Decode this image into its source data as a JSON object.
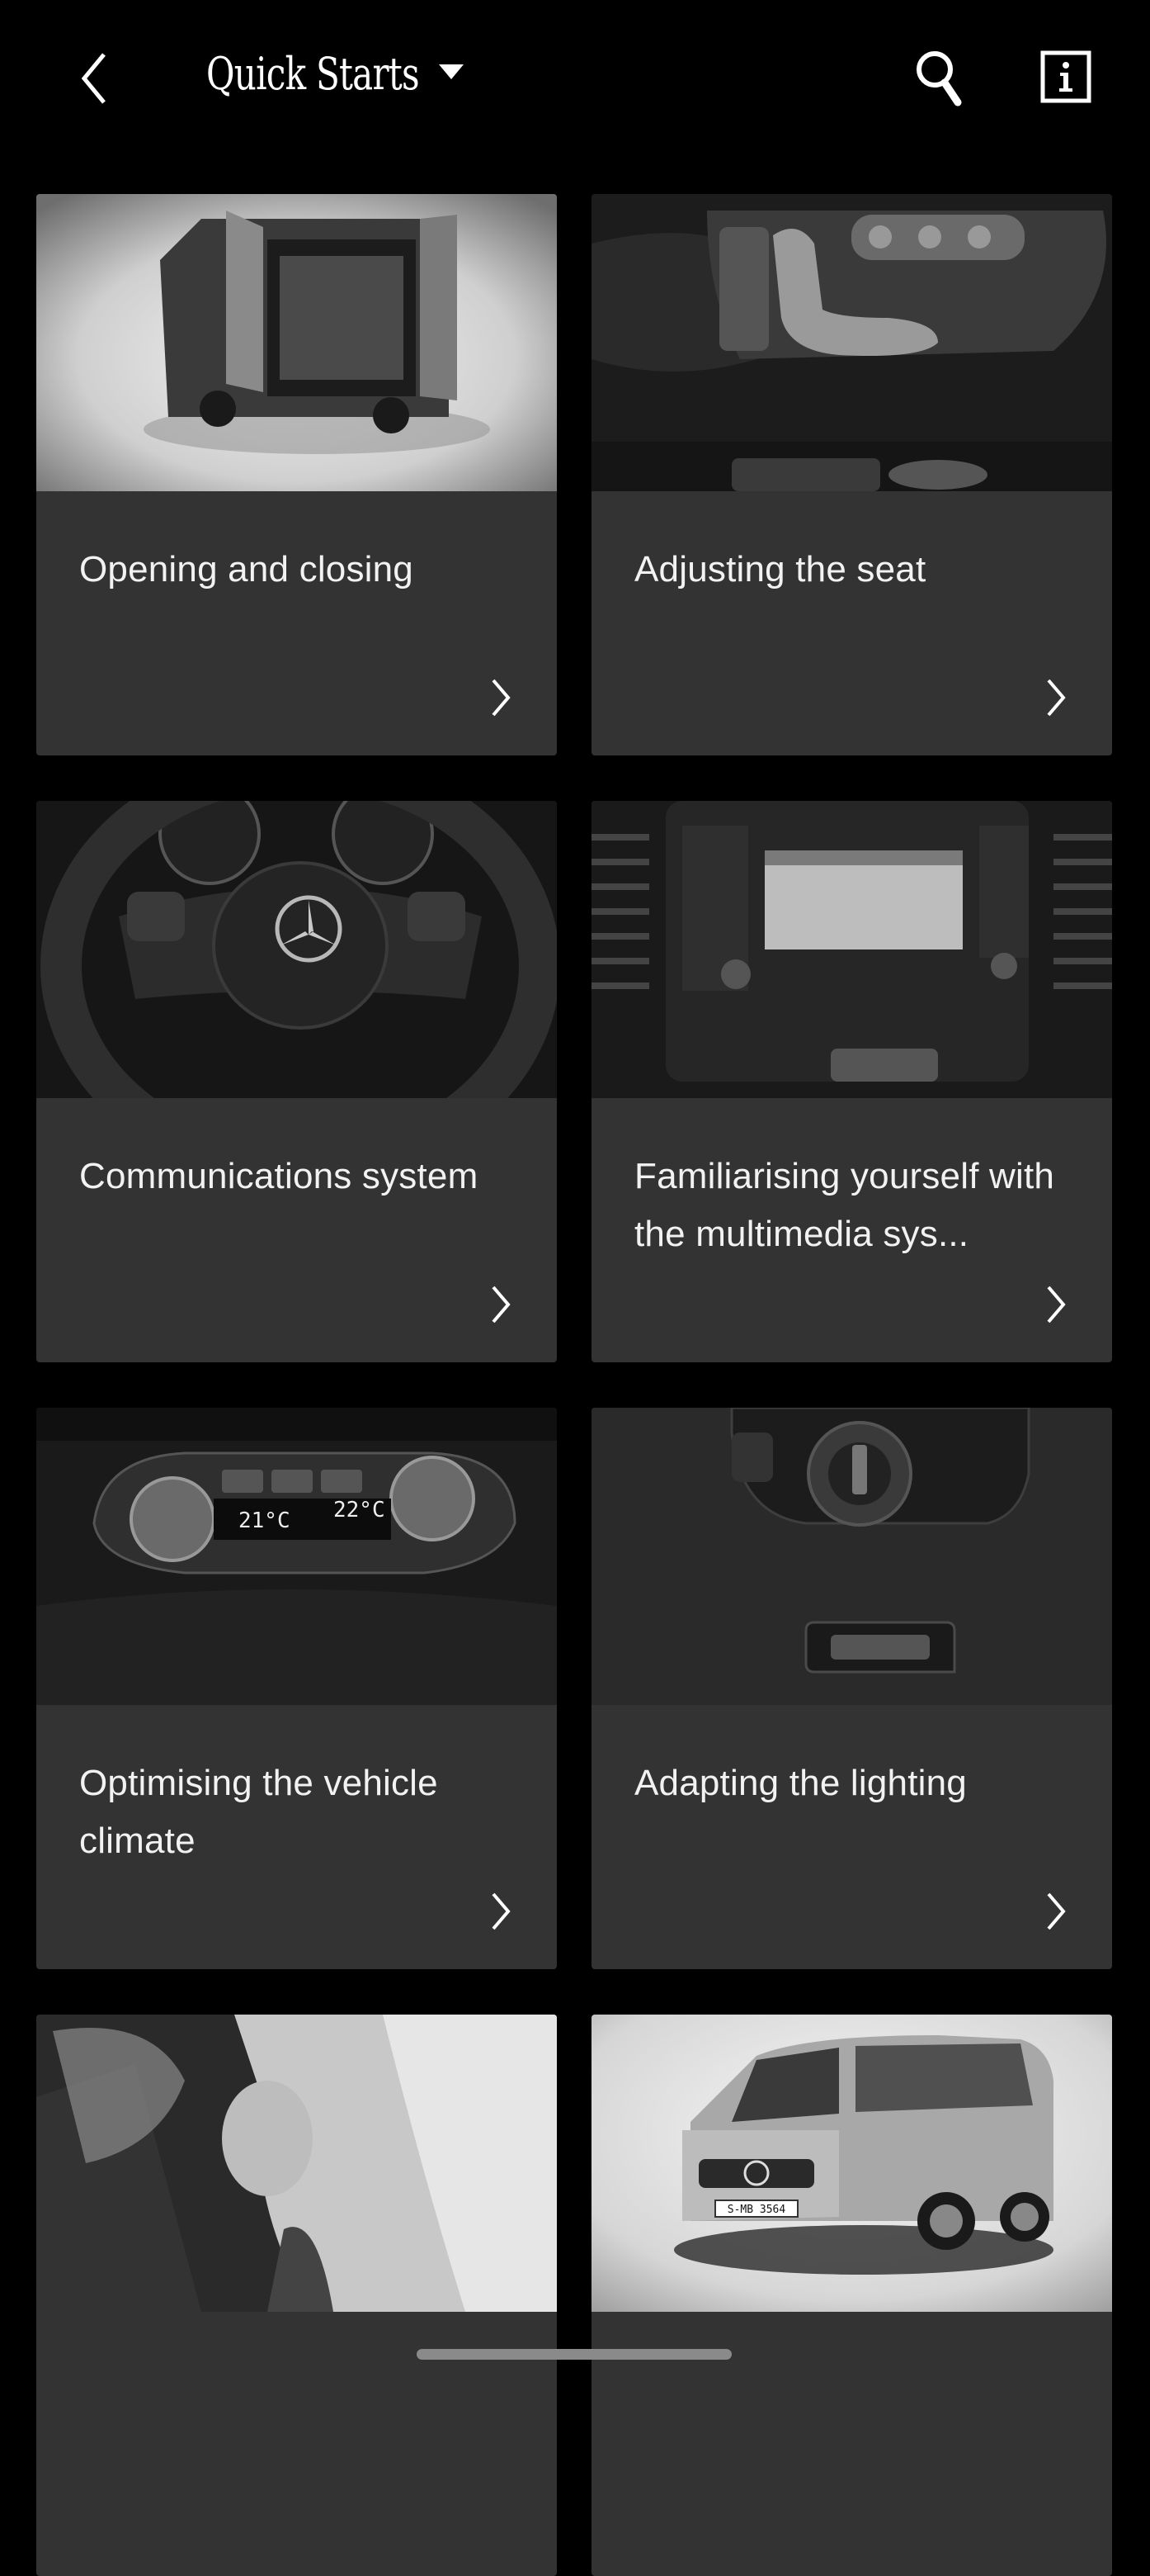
{
  "header": {
    "title": "Quick Starts",
    "icons": [
      "back-chevron-icon",
      "dropdown-caret-icon",
      "search-icon",
      "info-icon"
    ]
  },
  "cards": [
    {
      "label": "Opening and closing",
      "image": "van-rear-doors-open"
    },
    {
      "label": "Adjusting the seat",
      "image": "seat-adjustment-controls"
    },
    {
      "label": "Communications system",
      "image": "steering-wheel"
    },
    {
      "label": "Familiarising yourself with the multimedia sys...",
      "image": "multimedia-head-unit"
    },
    {
      "label": "Optimising the vehicle climate",
      "image": "climate-control-panel",
      "climate_left_temp": "21°C",
      "climate_right_temp": "22°C"
    },
    {
      "label": "Adapting the lighting",
      "image": "light-switch-panel"
    },
    {
      "label": "",
      "image": "airbags-deployed"
    },
    {
      "label": "",
      "image": "van-front-exterior",
      "plate": "S-MB 3564"
    }
  ],
  "colors": {
    "background": "#000000",
    "card": "#333333",
    "text": "#f2f2f2",
    "home_indicator": "#8a8a8a"
  }
}
